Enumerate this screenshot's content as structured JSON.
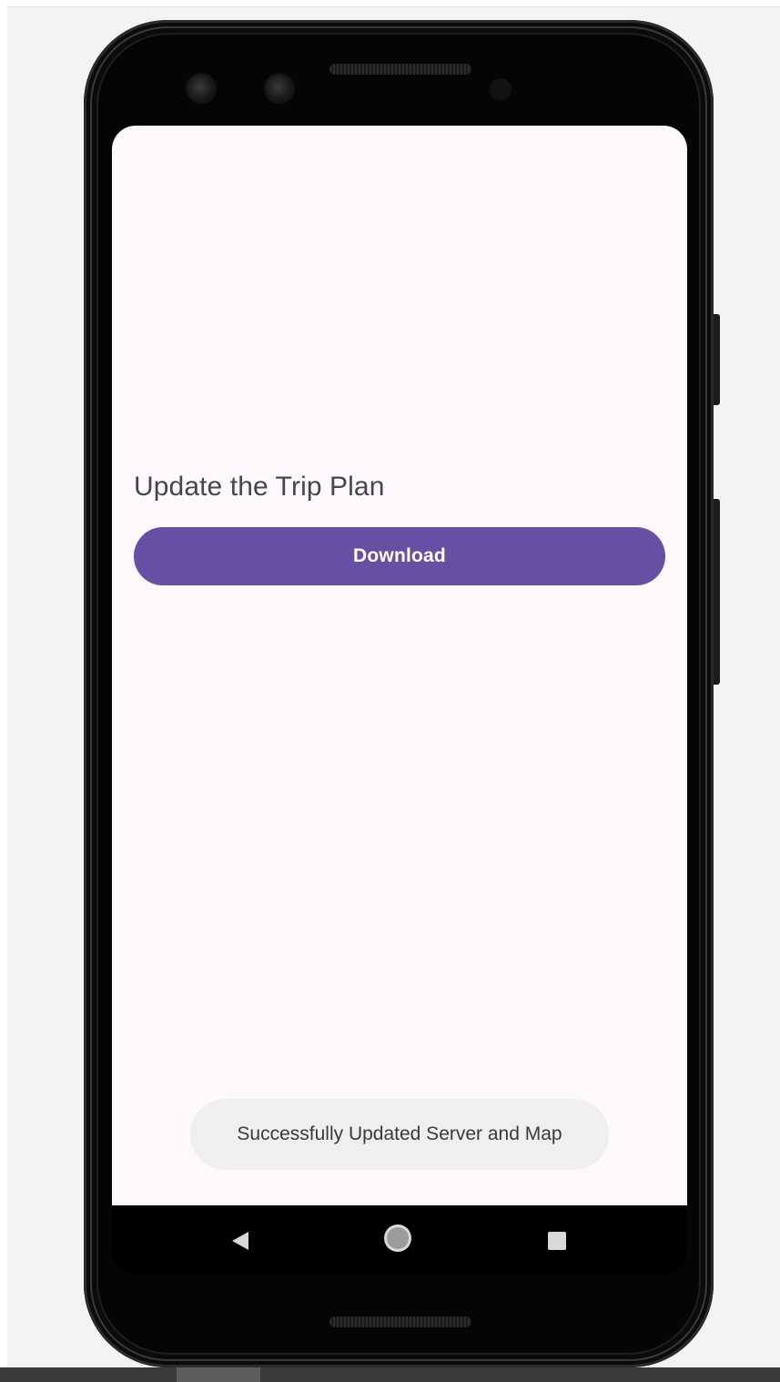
{
  "app": {
    "heading": "Update the Trip Plan",
    "download_label": "Download",
    "toast_message": "Successfully Updated Server and Map"
  },
  "navbar": {
    "back_icon": "back-triangle-icon",
    "home_icon": "home-circle-icon",
    "recent_icon": "recent-apps-square-icon"
  },
  "colors": {
    "primary": "#6750a4",
    "screen_background": "#fdf8fc",
    "toast_background": "#efefef",
    "heading_text": "#48454e"
  }
}
